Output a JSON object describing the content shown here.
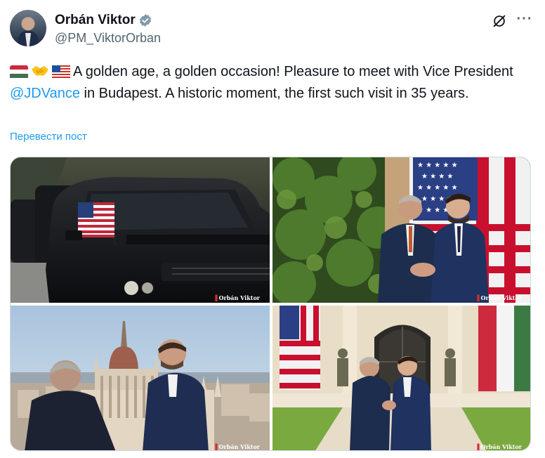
{
  "header": {
    "display_name": "Orbán Viktor",
    "handle": "@PM_ViktorOrban",
    "icons": {
      "verified": "verified-badge-icon",
      "grok": "grok-icon",
      "more": "more-options-icon"
    }
  },
  "tweet": {
    "emojis": [
      "flag-hungary",
      "handshake",
      "flag-usa"
    ],
    "text_before_mention": "A golden age, a golden occasion! Pleasure to meet with Vice President ",
    "mention": "@JDVance",
    "text_after_mention": " in Budapest. A historic moment, the first such visit in 35 years.",
    "translate_link": "Перевести пост"
  },
  "media": {
    "watermark": "Orbán Viktor",
    "photos": [
      {
        "alt": "motorcade-black-suv-with-us-flag"
      },
      {
        "alt": "handshake-in-front-of-us-flag-and-hedge"
      },
      {
        "alt": "two-men-overlooking-parliament-budapest"
      },
      {
        "alt": "handshake-between-flags-with-guards"
      }
    ]
  },
  "colors": {
    "link": "#1d9bf0",
    "text": "#0f1419",
    "secondary": "#536471",
    "verified": "#829aab"
  }
}
